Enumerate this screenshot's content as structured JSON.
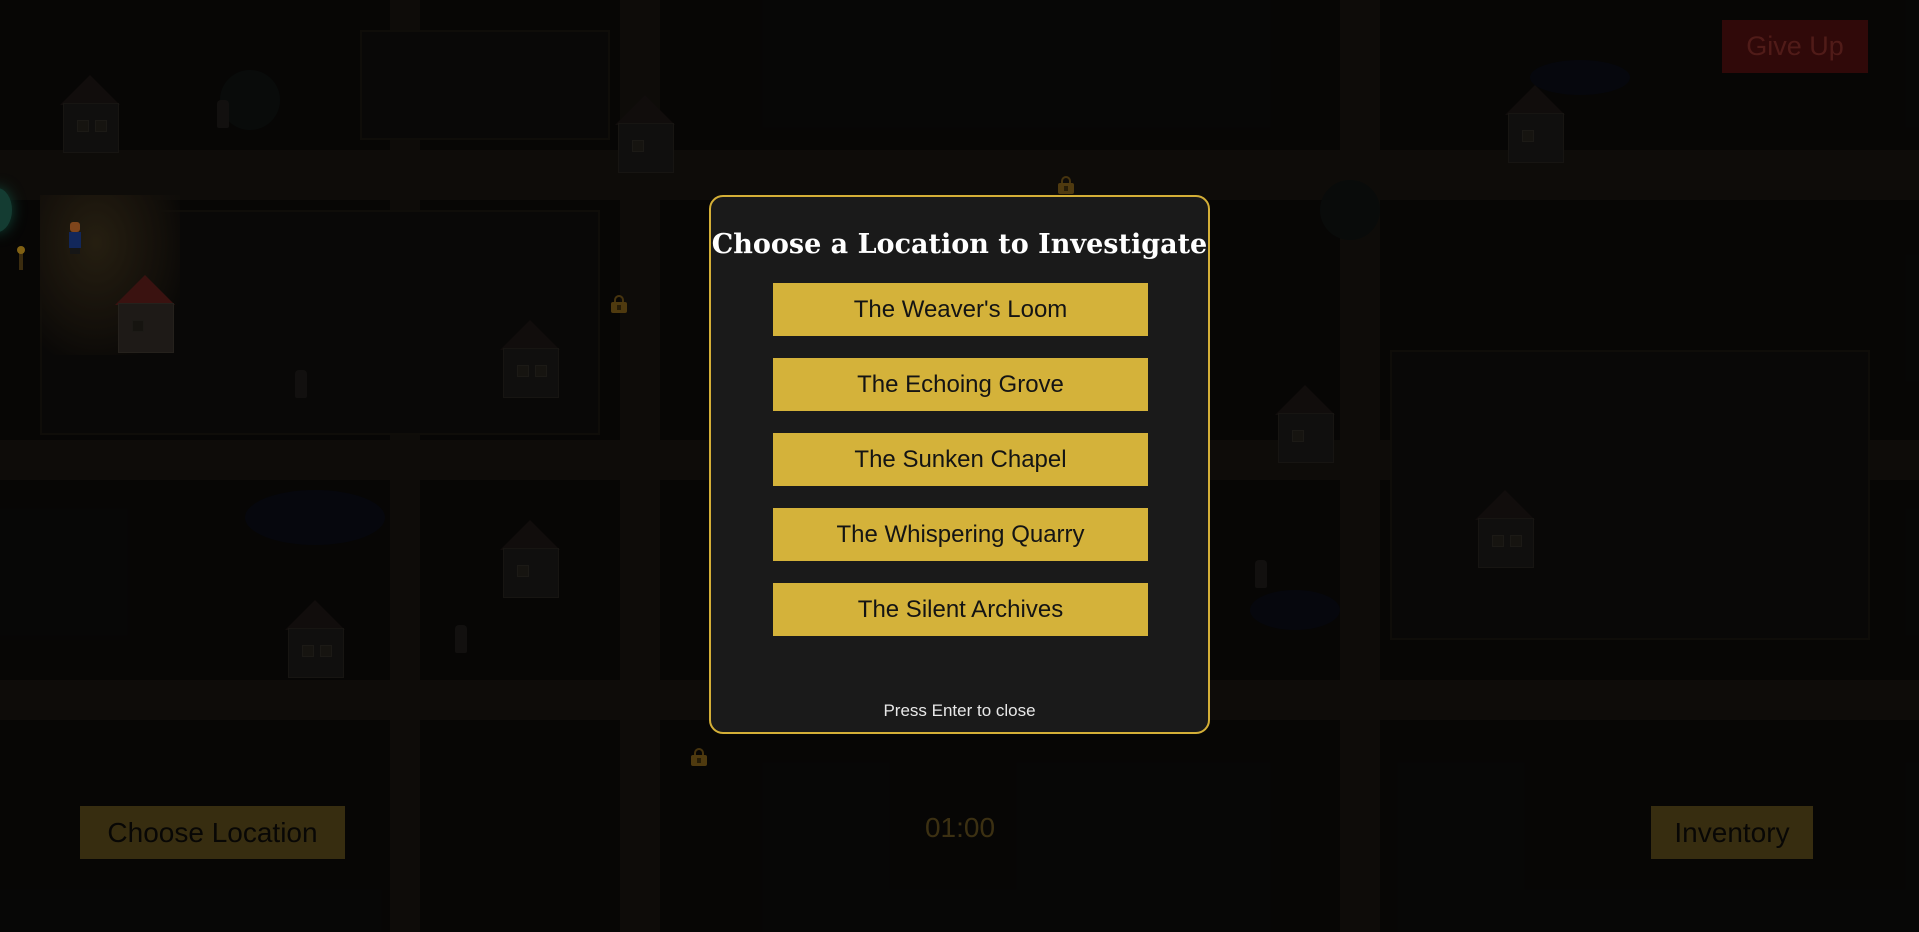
{
  "hud": {
    "give_up_label": "Give Up",
    "choose_location_label": "Choose Location",
    "inventory_label": "Inventory",
    "timer": "01:00"
  },
  "modal": {
    "title": "Choose a Location to Investigate",
    "locations": [
      {
        "label": "The Weaver's Loom"
      },
      {
        "label": "The Echoing Grove"
      },
      {
        "label": "The Sunken Chapel"
      },
      {
        "label": "The Whispering Quarry"
      },
      {
        "label": "The Silent Archives"
      }
    ],
    "hint": "Press Enter to close"
  },
  "colors": {
    "accent_gold": "#d4af37",
    "button_gold": "#d4b23a",
    "modal_bg": "#1a1a1a",
    "give_up_red": "#4a0e0e"
  },
  "icons": {
    "locked_marker": "padlock-icon",
    "player": "player-sprite"
  }
}
